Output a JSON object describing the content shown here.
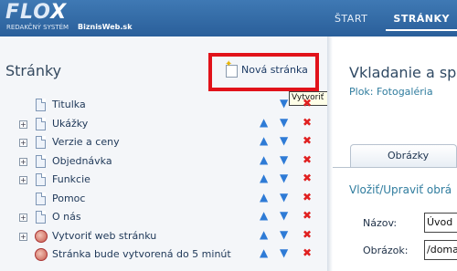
{
  "header": {
    "logo": "FLO",
    "logo_x": "X",
    "logo_sub": "REDAKČNÝ SYSTÉM",
    "site": "BiznisWeb.sk",
    "nav": [
      "ŠTART",
      "STRÁNKY"
    ],
    "active_nav": "STRÁNKY"
  },
  "left": {
    "title": "Stránky",
    "new_page_label": "Nová stránka",
    "tooltip": "Vytvoriť novú stránku",
    "rows": [
      {
        "label": "Titulka",
        "expander": false,
        "icon": "doc",
        "actions": "down-delete"
      },
      {
        "label": "Ukážky",
        "expander": true,
        "icon": "doc",
        "actions": "all"
      },
      {
        "label": "Verzie a ceny",
        "expander": true,
        "icon": "doc",
        "actions": "all"
      },
      {
        "label": "Objednávka",
        "expander": true,
        "icon": "doc",
        "actions": "all"
      },
      {
        "label": "Funkcie",
        "expander": true,
        "icon": "doc",
        "actions": "all"
      },
      {
        "label": "Pomoc",
        "expander": false,
        "icon": "doc",
        "actions": "all"
      },
      {
        "label": "O nás",
        "expander": true,
        "icon": "doc",
        "actions": "all"
      },
      {
        "label": "Vytvoriť web stránku",
        "expander": true,
        "icon": "globe",
        "actions": "all"
      },
      {
        "label": "Stránka bude vytvorená do 5 minút",
        "expander": false,
        "icon": "globe",
        "actions": "all"
      }
    ],
    "icons": {
      "up": "▲",
      "down": "▼",
      "delete": "✖",
      "expander": "+"
    }
  },
  "right": {
    "title": "Vkladanie a spr",
    "path": "Plok: Fotogaléria",
    "tab": "Obrázky",
    "section": "Vložiť/Upraviť obrá",
    "fields": [
      {
        "label": "Názov:",
        "value": "Úvod"
      },
      {
        "label": "Obrázok:",
        "value": "/doma"
      }
    ]
  },
  "colors": {
    "header": "#2f6aa6",
    "accent_red": "#e1121a",
    "arrow_blue": "#2e7bd6"
  }
}
